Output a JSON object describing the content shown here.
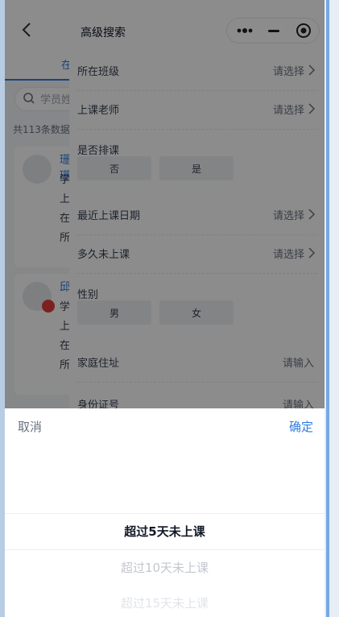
{
  "background_page": {
    "tab_label": "在",
    "search_placeholder": "学员姓",
    "count_text": "共113条数据",
    "cards": [
      {
        "name": "珊珊",
        "lines": [
          "学管",
          "上课",
          "在读",
          "所在"
        ]
      },
      {
        "name": "邱",
        "lines": [
          "学管",
          "上课",
          "在读",
          "所在"
        ]
      }
    ]
  },
  "filter_panel": {
    "title": "高级搜索",
    "capsule": {
      "more_icon": "more-dots-icon",
      "minimize_icon": "minus-icon",
      "close_icon": "target-close-icon"
    },
    "rows": [
      {
        "label": "所在班级",
        "value": "请选择"
      },
      {
        "label": "上课老师",
        "value": "请选择"
      },
      {
        "label": "最近上课日期",
        "value": "请选择"
      },
      {
        "label": "多久未上课",
        "value": "请选择"
      },
      {
        "label": "家庭住址",
        "value": "请输入"
      },
      {
        "label": "身份证号",
        "value": "请输入"
      }
    ],
    "scheduled": {
      "label": "是否排课",
      "options": [
        "否",
        "是"
      ]
    },
    "gender": {
      "label": "性别",
      "options": [
        "男",
        "女"
      ]
    }
  },
  "picker": {
    "cancel_label": "取消",
    "confirm_label": "确定",
    "options": [
      "超过5天未上课",
      "超过10天未上课",
      "超过15天未上课"
    ],
    "selected_index": 0
  },
  "colors": {
    "accent": "#2f7de1",
    "overlay": "rgba(0,0,0,0.45)"
  }
}
